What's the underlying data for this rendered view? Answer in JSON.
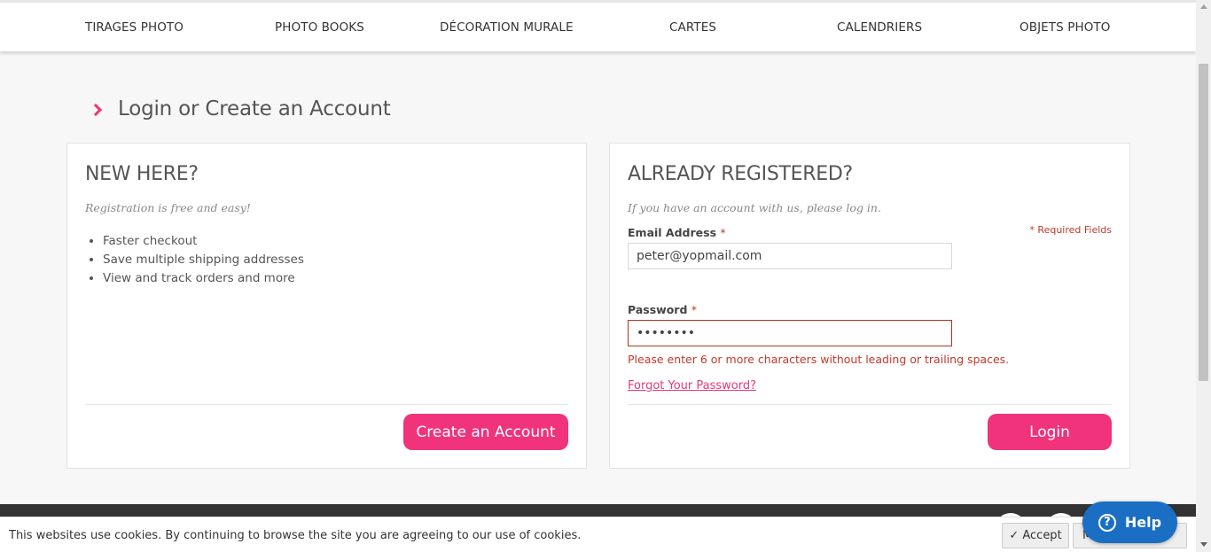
{
  "nav": {
    "items": [
      {
        "label": "TIRAGES PHOTO"
      },
      {
        "label": "PHOTO BOOKS"
      },
      {
        "label": "DÉCORATION MURALE"
      },
      {
        "label": "CARTES"
      },
      {
        "label": "CALENDRIERS"
      },
      {
        "label": "OBJETS PHOTO"
      }
    ]
  },
  "page": {
    "title": "Login or Create an Account"
  },
  "new_here": {
    "heading": "NEW HERE?",
    "subtitle": "Registration is free and easy!",
    "benefits": [
      "Faster checkout",
      "Save multiple shipping addresses",
      "View and track orders and more"
    ],
    "create_button": "Create an Account"
  },
  "registered": {
    "heading": "ALREADY REGISTERED?",
    "subtitle": "If you have an account with us, please log in.",
    "required_note": "* Required Fields",
    "email_label": "Email Address",
    "email_value": "peter@yopmail.com",
    "password_label": "Password",
    "password_value": "••••••••",
    "required_star": "*",
    "error_message": "Please enter 6 or more characters without leading or trailing spaces.",
    "forgot_link": "Forgot Your Password?",
    "login_button": "Login"
  },
  "cookie": {
    "text": "This websites use cookies. By continuing to browse the site you are agreeing to our use of cookies.",
    "accept_label": "✓ Accept",
    "more_label": "M"
  },
  "help": {
    "label": "Help",
    "icon": "question-circle-icon"
  },
  "colors": {
    "accent": "#f0337a",
    "error": "#c0392b",
    "help_blue": "#1a6fc4"
  }
}
